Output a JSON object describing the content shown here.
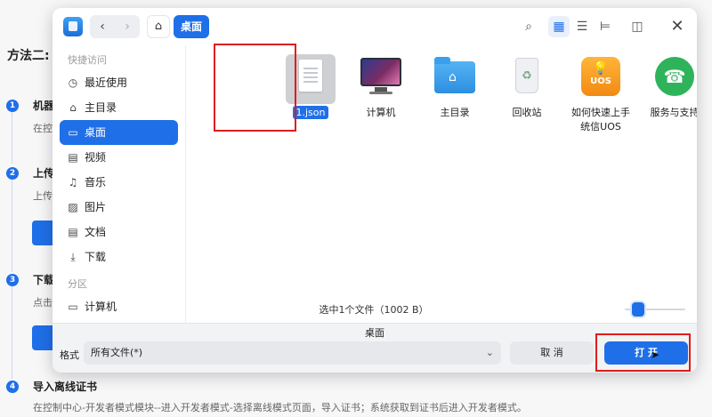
{
  "background": {
    "heading": "方法二:",
    "steps": [
      {
        "num": "1",
        "title": "机器",
        "desc": "在控"
      },
      {
        "num": "2",
        "title": "上传",
        "desc": "上传"
      },
      {
        "num": "3",
        "title": "下载",
        "desc": "点击"
      },
      {
        "num": "4",
        "title": "导入离线证书",
        "desc": "在控制中心-开发者模式模块--进入开发者模式-选择离线模式页面，导入证书；系统获取到证书后进入开发者模式。"
      }
    ]
  },
  "dialog": {
    "nav": {
      "back": "‹",
      "forward": "›"
    },
    "breadcrumb": "桌面",
    "sidebar": {
      "group_quick": "快捷访问",
      "items": [
        {
          "label": "最近使用",
          "icon": "clock-icon",
          "glyph": "◷"
        },
        {
          "label": "主目录",
          "icon": "home-icon",
          "glyph": "⌂"
        },
        {
          "label": "桌面",
          "icon": "desktop-icon",
          "glyph": "▭"
        },
        {
          "label": "视频",
          "icon": "video-icon",
          "glyph": "▤"
        },
        {
          "label": "音乐",
          "icon": "music-icon",
          "glyph": "♫"
        },
        {
          "label": "图片",
          "icon": "picture-icon",
          "glyph": "▨"
        },
        {
          "label": "文档",
          "icon": "document-icon",
          "glyph": "▤"
        },
        {
          "label": "下载",
          "icon": "download-icon",
          "glyph": "⤓"
        }
      ],
      "group_partition": "分区",
      "partition_items": [
        {
          "label": "计算机",
          "icon": "computer-icon",
          "glyph": "▭"
        }
      ]
    },
    "files": [
      {
        "label": "1.json",
        "icon": "json-file-icon"
      },
      {
        "label": "计算机",
        "icon": "computer-icon"
      },
      {
        "label": "主目录",
        "icon": "home-folder-icon"
      },
      {
        "label": "回收站",
        "icon": "trash-icon"
      },
      {
        "label": "如何快速上手统信UOS",
        "line1": "如何快速上手",
        "line2": "统信UOS",
        "icon": "uos-guide-icon",
        "badge": "UOS"
      },
      {
        "label": "服务与支持",
        "icon": "support-icon"
      }
    ],
    "status": "选中1个文件（1002 B）",
    "zoom_fraction": 0.15,
    "filename": "桌面",
    "format_label": "格式",
    "format_value": "所有文件(*)",
    "cancel_label": "取 消",
    "open_label": "打 开"
  },
  "colors": {
    "accent": "#1f6fe8",
    "annotation": "#e11b1b"
  }
}
